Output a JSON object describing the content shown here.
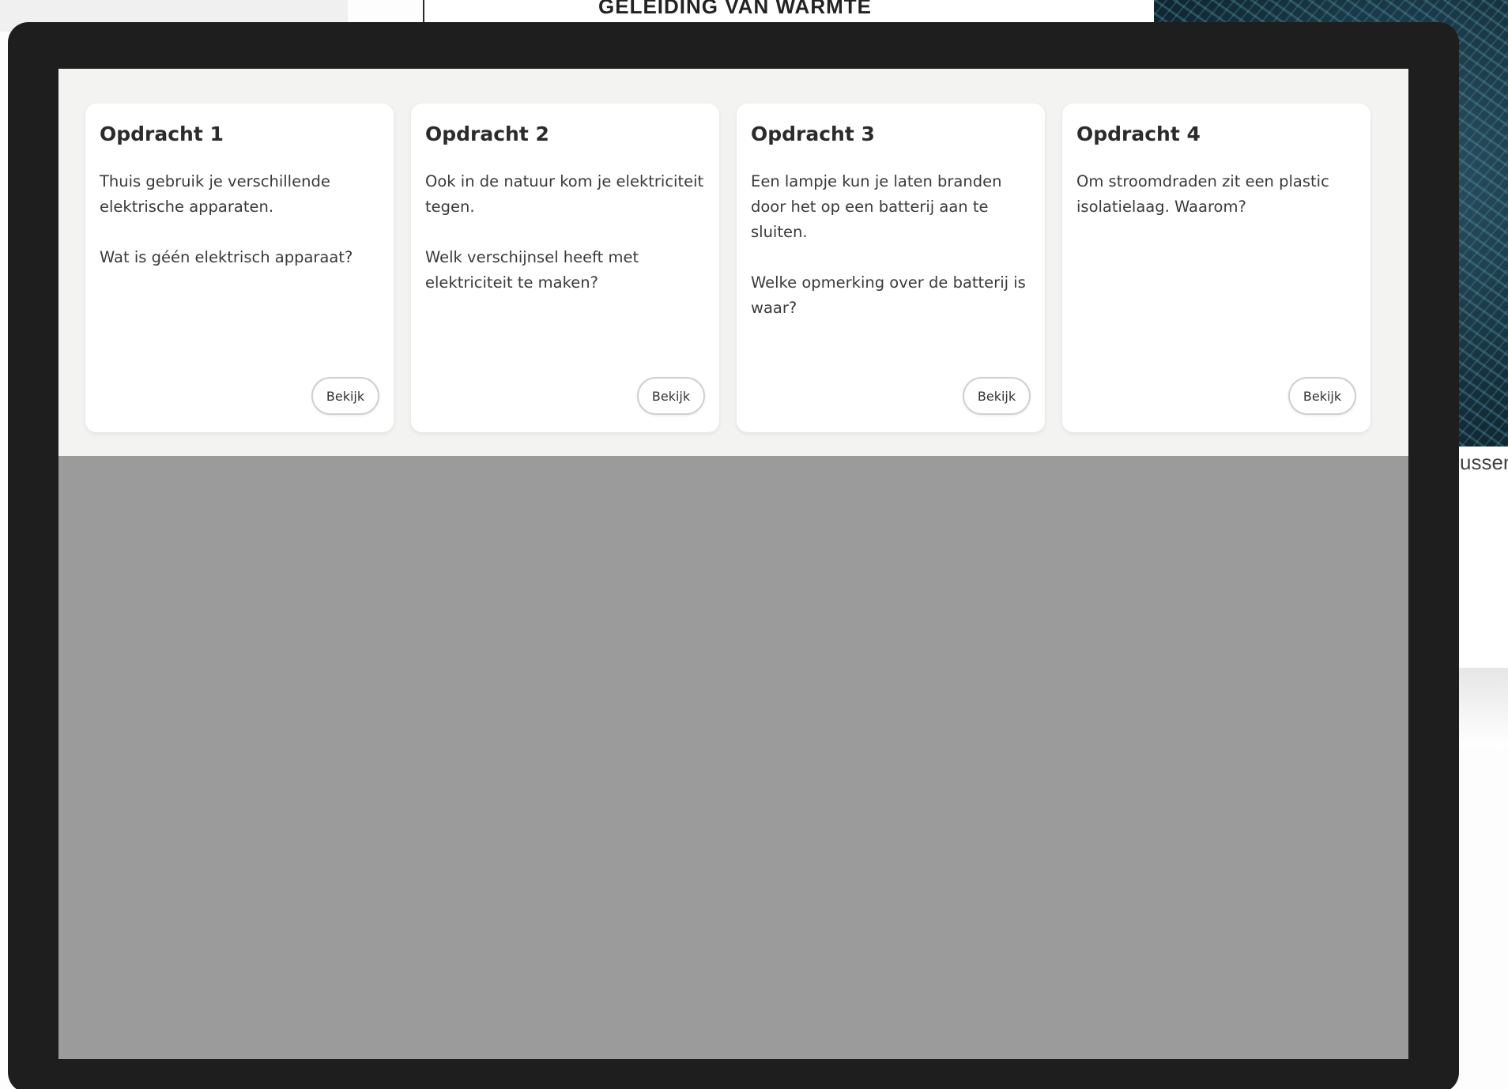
{
  "background": {
    "heading": "GELEIDING VAN WARMTE",
    "right_text": "ussen"
  },
  "cards": [
    {
      "title": "Opdracht 1",
      "paragraphs": [
        "Thuis gebruik je verschillende elektrische apparaten.",
        "Wat is géén elektrisch apparaat?"
      ],
      "button": "Bekijk"
    },
    {
      "title": "Opdracht 2",
      "paragraphs": [
        "Ook in de natuur kom je elektriciteit tegen.",
        "Welk verschijnsel heeft met elektriciteit te maken?"
      ],
      "button": "Bekijk"
    },
    {
      "title": "Opdracht 3",
      "paragraphs": [
        "Een lampje kun je laten branden door het op een batterij aan te sluiten.",
        "Welke opmerking over de batterij is waar?"
      ],
      "button": "Bekijk"
    },
    {
      "title": "Opdracht 4",
      "paragraphs": [
        "Om stroomdraden zit een plastic isolatielaag. Waarom?"
      ],
      "button": "Bekijk"
    }
  ]
}
